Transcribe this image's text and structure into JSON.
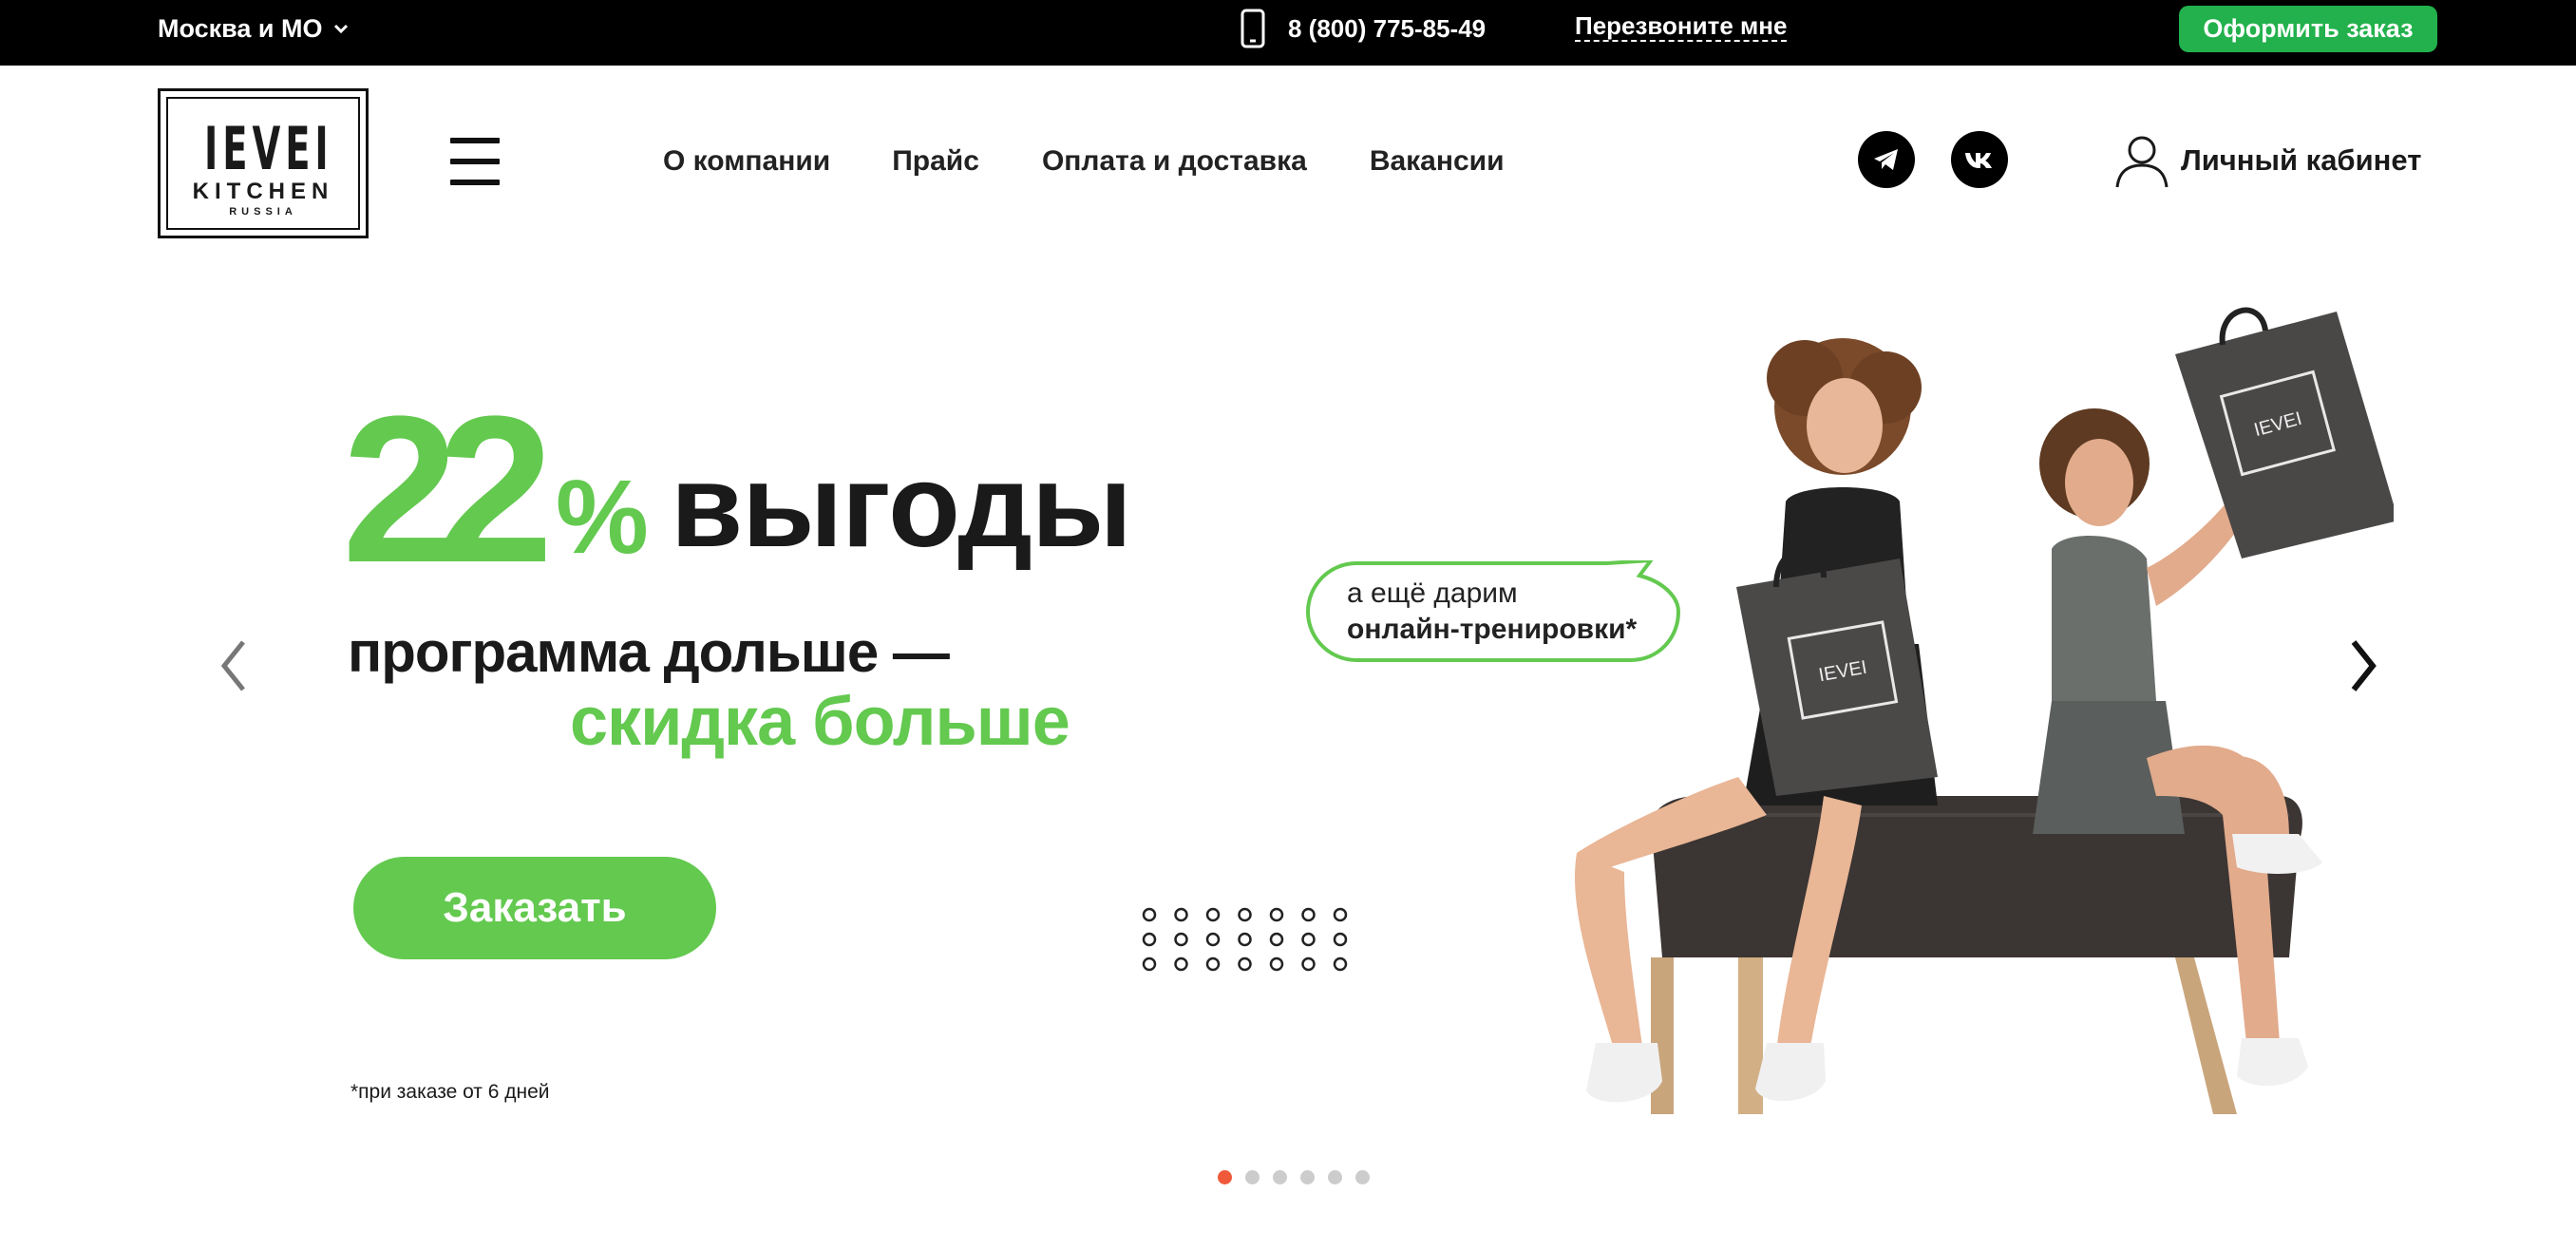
{
  "topbar": {
    "region": "Москва и МО",
    "phone": "8 (800) 775-85-49",
    "callback": "Перезвоните мне",
    "order": "Оформить заказ"
  },
  "header": {
    "logo": {
      "line1": "IEVEI",
      "line2": "KITCHEN",
      "line3": "RUSSIA"
    },
    "nav": [
      "О компании",
      "Прайс",
      "Оплата и доставка",
      "Вакансии"
    ],
    "social": [
      "telegram-icon",
      "vk-icon"
    ],
    "account": "Личный кабинет"
  },
  "hero": {
    "percent_number": "22",
    "percent_sign": "%",
    "title": "выгоды",
    "subtitle_line1": "программа дольше —",
    "subtitle_line2": "скидка больше",
    "bubble_line1": "а ещё дарим",
    "bubble_line2": "онлайн-тренировки*",
    "order_button": "Заказать",
    "footnote": "*при заказе от 6 дней"
  },
  "slider": {
    "slides": 6,
    "active": 1
  },
  "colors": {
    "accent": "#63c94f",
    "order_green": "#22b14c",
    "pager_active": "#f05a3a",
    "topbar": "#000000"
  }
}
